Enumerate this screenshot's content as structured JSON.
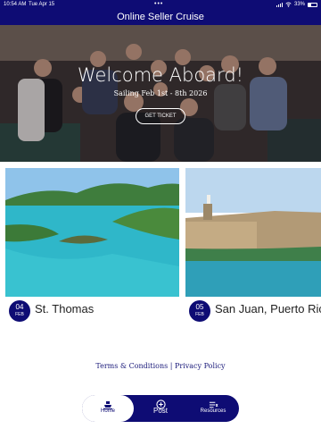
{
  "status_bar": {
    "time": "10:54 AM",
    "date": "Tue Apr 15",
    "dots": "•••",
    "battery": "33%"
  },
  "header": {
    "title": "Online Seller Cruise"
  },
  "hero": {
    "title": "Welcome Aboard!",
    "subtitle": "Sailing Feb 1st - 8th 2026",
    "button_label": "GET TICKET"
  },
  "ports": [
    {
      "day": "04",
      "month": "FEB",
      "name": "St. Thomas"
    },
    {
      "day": "05",
      "month": "FEB",
      "name": "San Juan, Puerto Rico"
    }
  ],
  "footer": {
    "terms": "Terms & Conditions",
    "separator": " | ",
    "privacy": "Privacy Policy"
  },
  "tabs": {
    "home": "Home",
    "post": "Post",
    "resources": "Resources"
  },
  "colors": {
    "primary": "#0e0c74",
    "sea": "#2bb3c8"
  }
}
